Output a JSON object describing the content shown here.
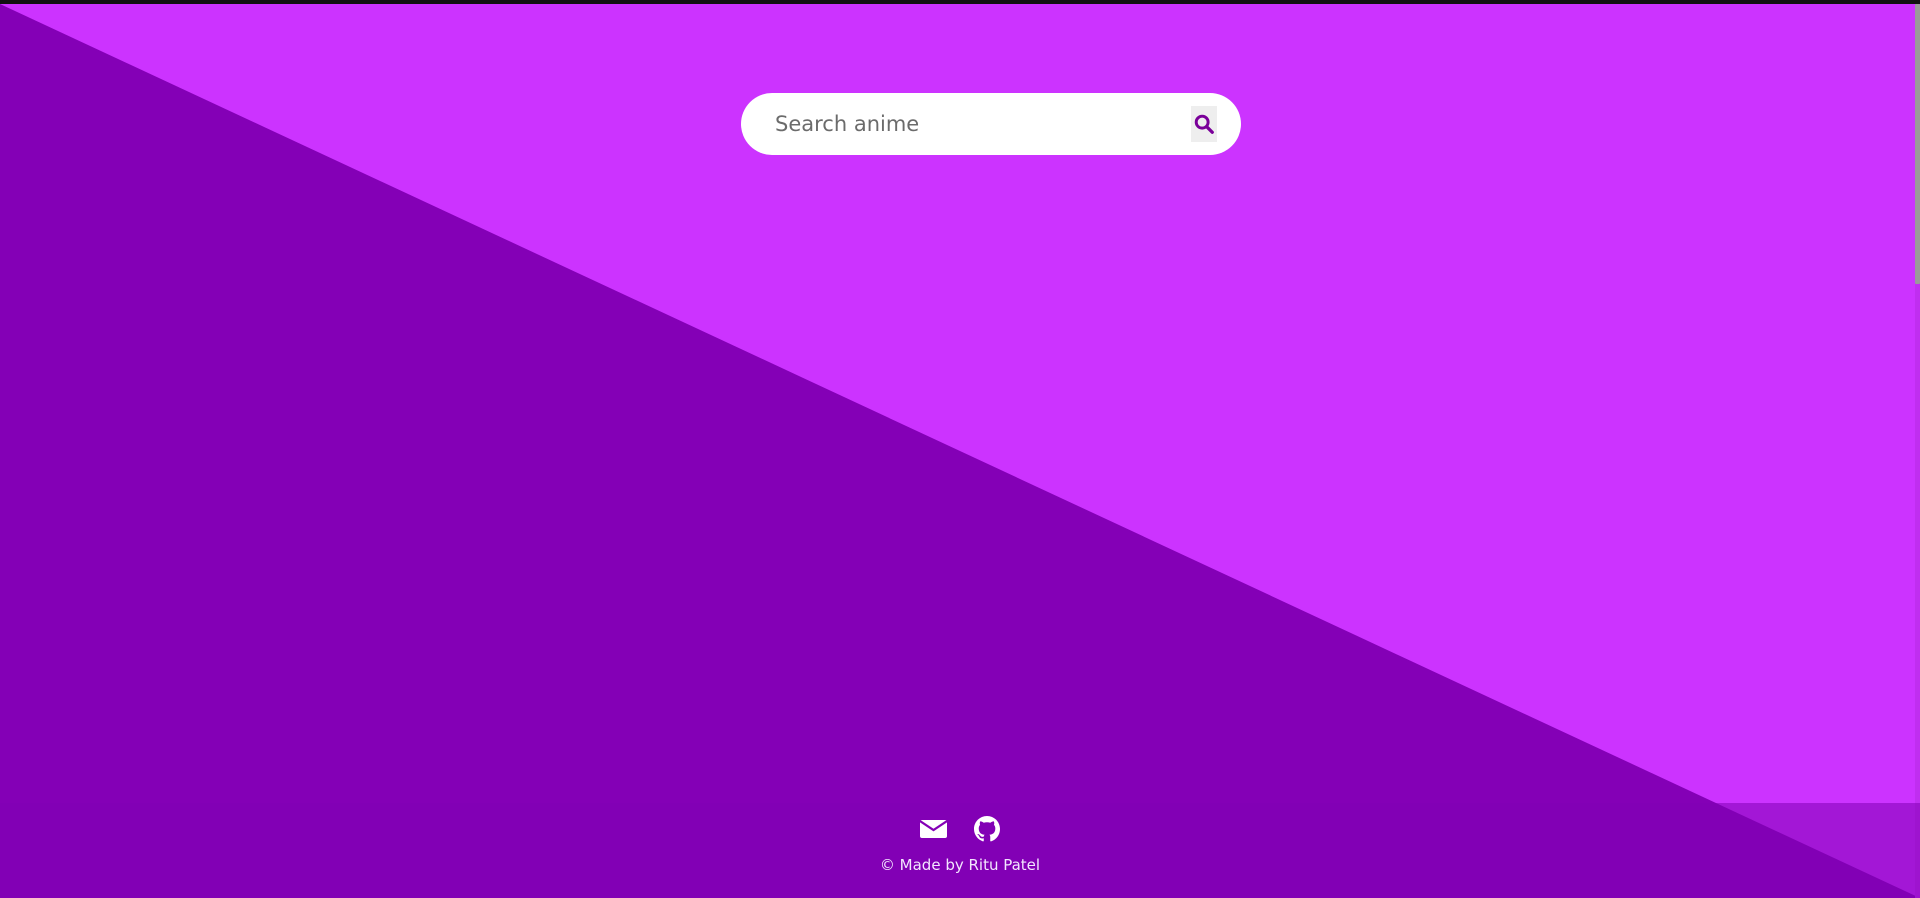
{
  "colors": {
    "background_light": "#cc33ff",
    "background_dark": "#8400b6",
    "search_icon": "#7a0099",
    "footer_text": "#f3e6ff"
  },
  "search": {
    "placeholder": "Search anime",
    "value": "",
    "button_icon": "search-icon"
  },
  "footer": {
    "icons": [
      "envelope-icon",
      "github-icon"
    ],
    "copyright": "© Made by Ritu Patel"
  }
}
